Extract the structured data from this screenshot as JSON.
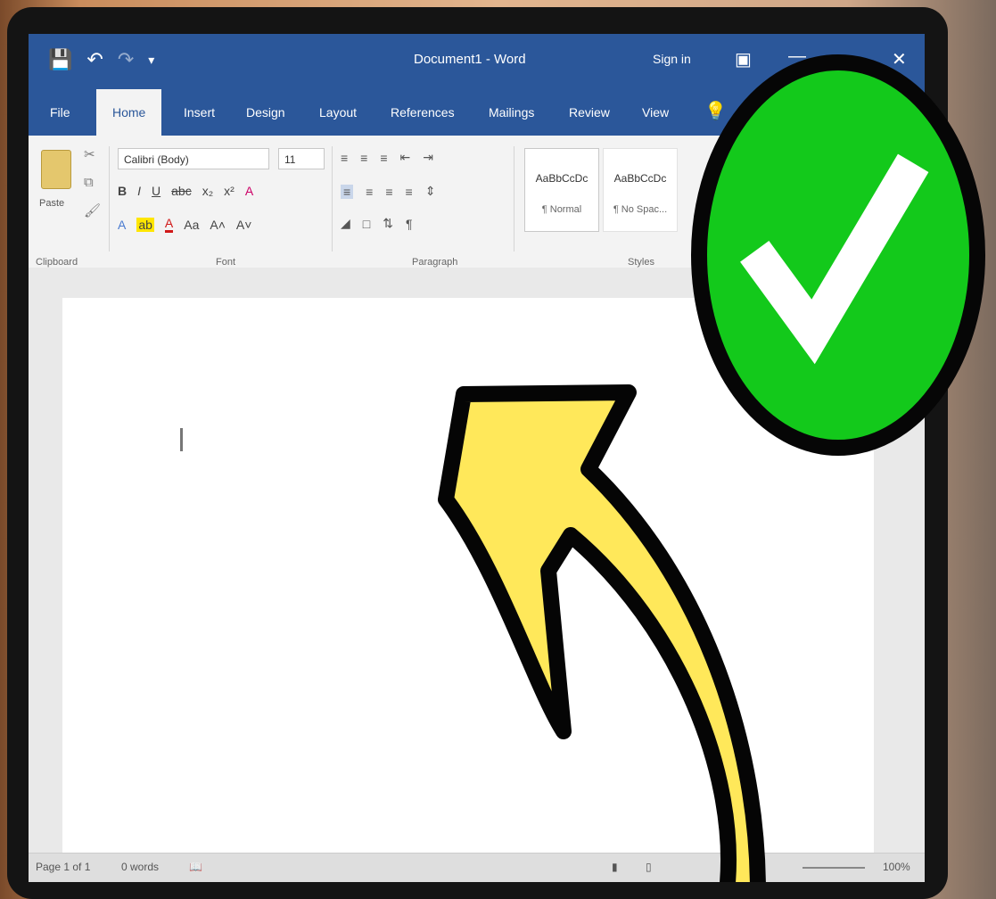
{
  "window": {
    "title": "Document1 - Word",
    "sign_in": "Sign in",
    "quick_access": [
      "save-icon",
      "undo-icon",
      "redo-icon",
      "customize-icon"
    ]
  },
  "tabs": [
    {
      "label": "File"
    },
    {
      "label": "Home",
      "active": true
    },
    {
      "label": "Insert"
    },
    {
      "label": "Design"
    },
    {
      "label": "Layout"
    },
    {
      "label": "References"
    },
    {
      "label": "Mailings"
    },
    {
      "label": "Review"
    },
    {
      "label": "View"
    }
  ],
  "ribbon": {
    "clipboard": {
      "paste_label": "Paste",
      "group_label": "Clipboard"
    },
    "font": {
      "name": "Calibri (Body)",
      "size": "11",
      "group_label": "Font"
    },
    "paragraph": {
      "group_label": "Paragraph"
    },
    "styles": {
      "group_label": "Styles",
      "items": [
        {
          "sample": "AaBbCcDc",
          "name": "¶ Normal"
        },
        {
          "sample": "AaBbCcDc",
          "name": "¶ No Spac..."
        }
      ]
    }
  },
  "statusbar": {
    "page": "Page 1 of 1",
    "words": "0 words",
    "zoom": "100%"
  },
  "colors": {
    "word_blue": "#2b579a",
    "arrow_yellow": "#ffe85a",
    "check_green": "#13c91b"
  }
}
